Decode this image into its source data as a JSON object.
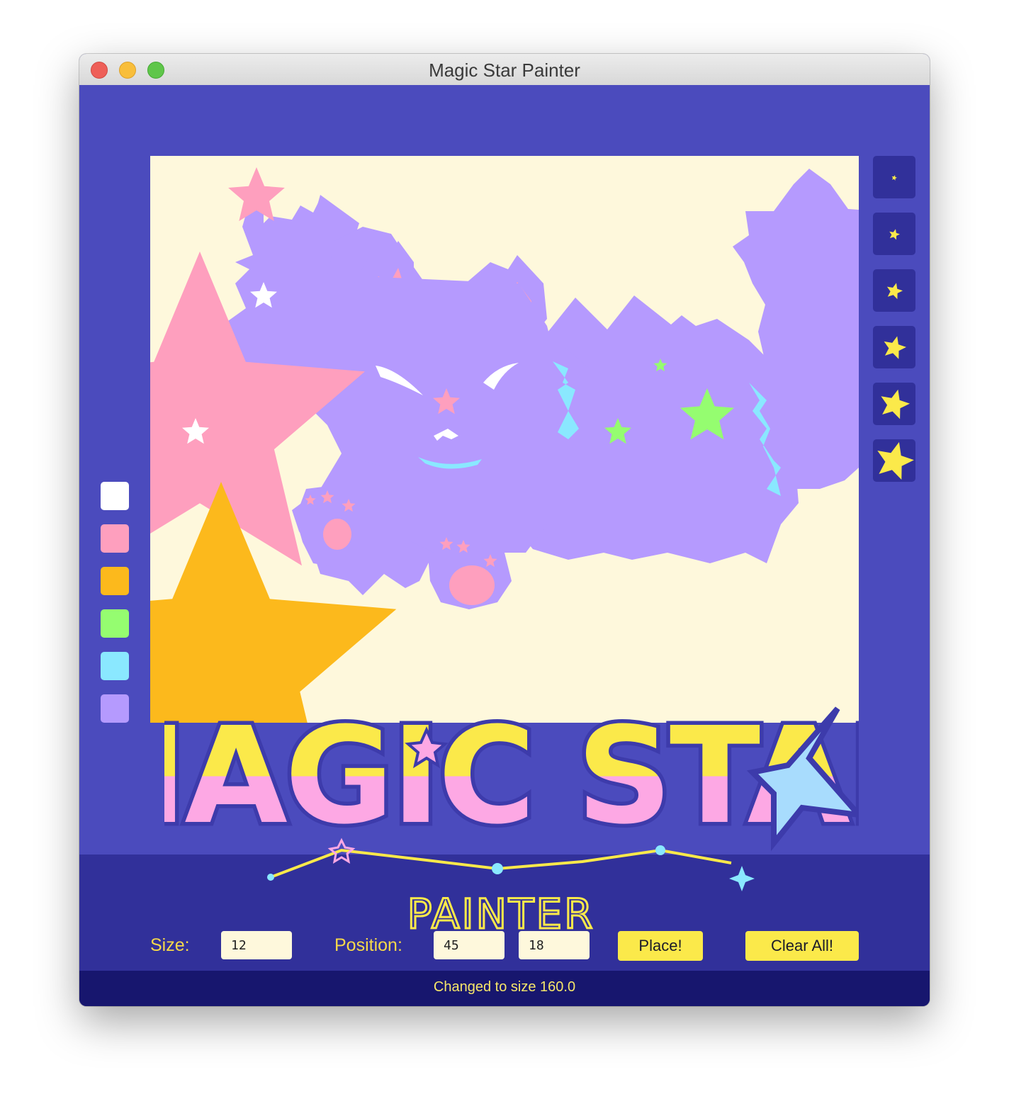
{
  "window": {
    "title": "Magic Star Painter"
  },
  "palette": {
    "colors": [
      "#ffffff",
      "#fe9fbe",
      "#fcb91c",
      "#95fd70",
      "#8ae8ff",
      "#b59afe"
    ],
    "names": [
      "white",
      "pink",
      "orange",
      "green",
      "cyan",
      "lavender"
    ]
  },
  "size_buttons": {
    "count": 6,
    "star_color": "#fbe94a"
  },
  "logo": {
    "line1": "MAGIC STAR",
    "line2": "PAINTER"
  },
  "controls": {
    "size_label": "Size:",
    "size_value": "12",
    "position_label": "Position:",
    "position_x": "45",
    "position_y": "18",
    "place_label": "Place!",
    "clear_label": "Clear All!"
  },
  "status": {
    "text": "Changed to size 160.0"
  }
}
